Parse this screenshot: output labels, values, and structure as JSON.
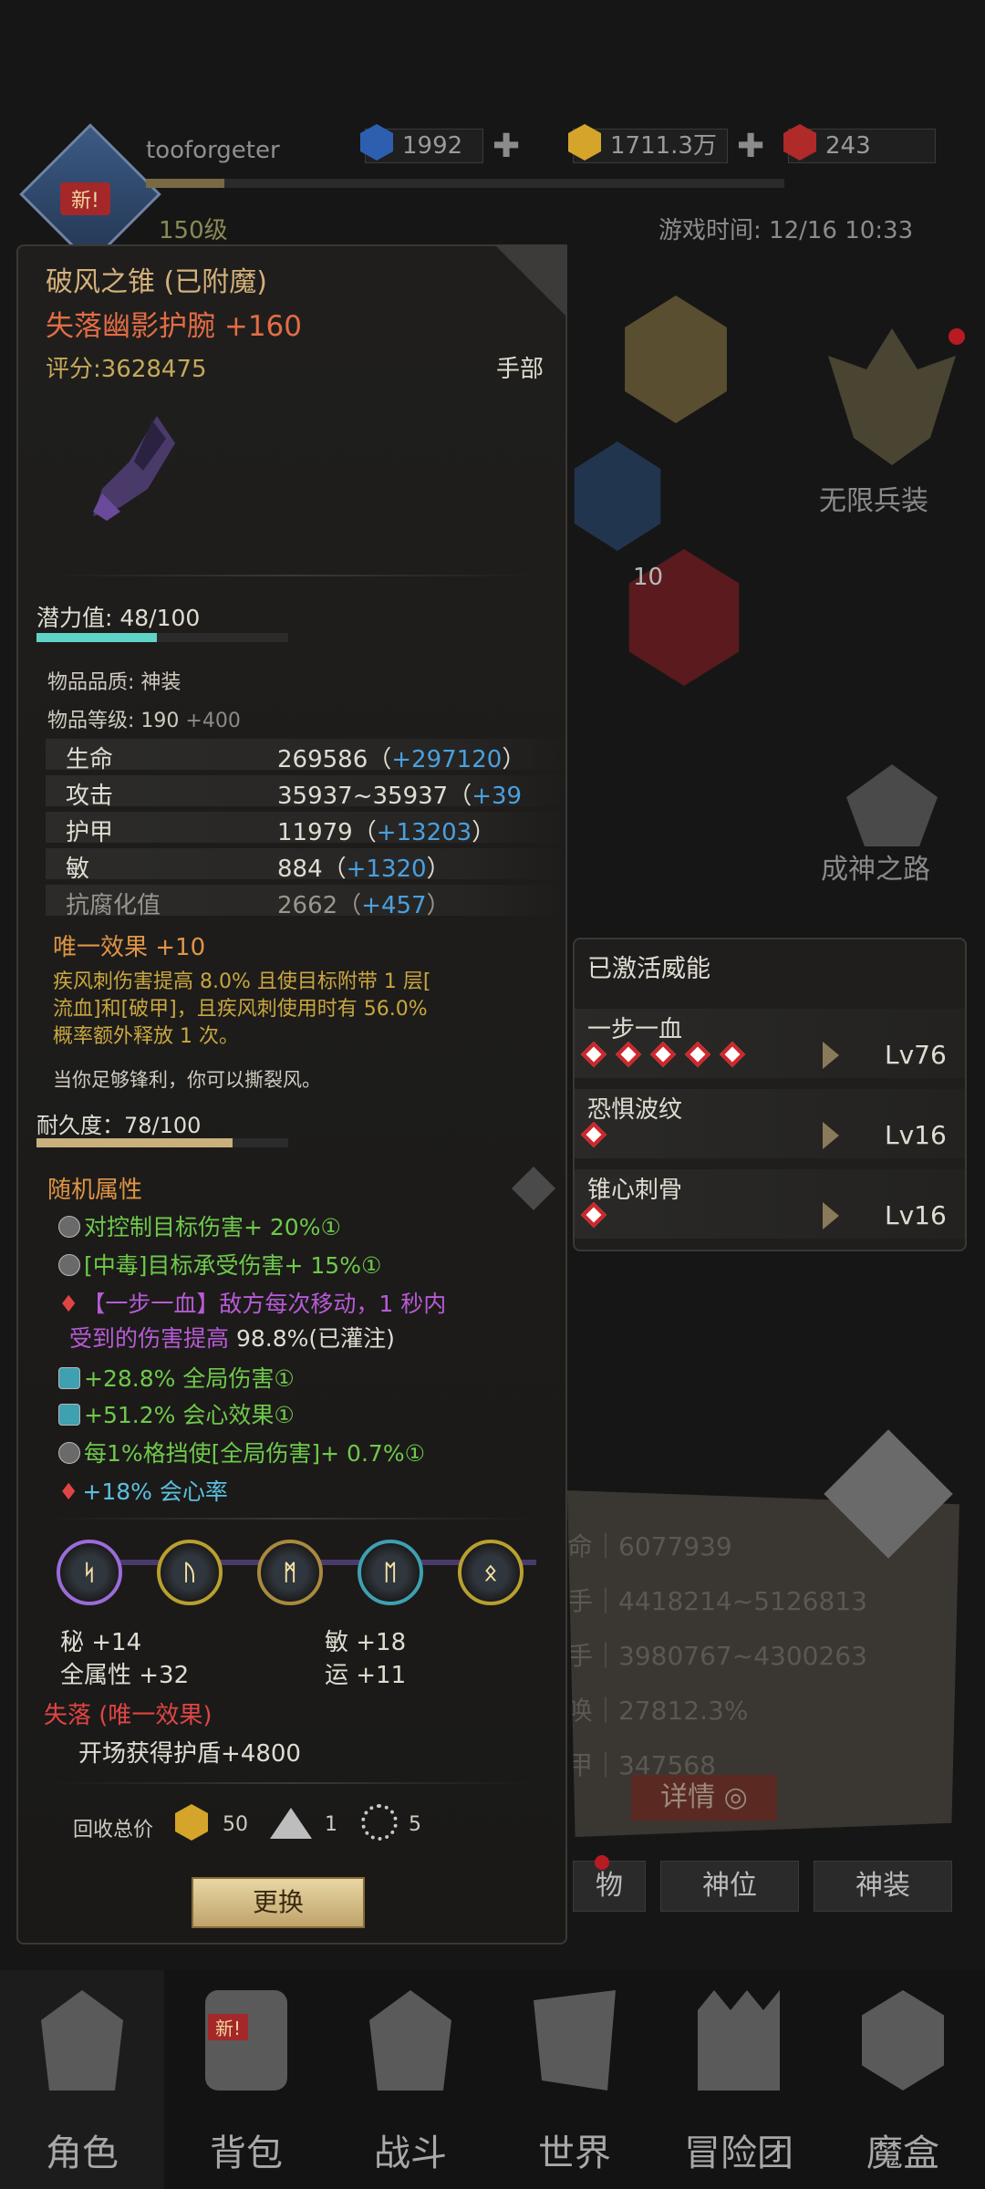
{
  "player": {
    "name": "tooforgeter",
    "level": "150级",
    "new_badge": "新!",
    "game_time": "游戏时间: 12/16 10:33"
  },
  "currency": [
    {
      "icon": "blue-gem-icon",
      "value": "1992",
      "color": "#2d5fb0"
    },
    {
      "icon": "gold-gem-icon",
      "value": "1711.3万",
      "color": "#d4a52a"
    },
    {
      "icon": "red-gem-icon",
      "value": "243",
      "color": "#b02a2a"
    }
  ],
  "side": {
    "infinite_equipment": "无限兵装",
    "godhood_path": "成神之路",
    "hex_level": "10"
  },
  "item": {
    "enchant_title": "破风之锥 (已附魔)",
    "name": "失落幽影护腕 +160",
    "score": "评分:3628475",
    "slot": "手部",
    "potential": "潜力值: 48/100",
    "potential_level": 0.48,
    "quality": "物品品质: 神装",
    "item_level": "物品等级: 190",
    "item_level_bonus": "+400",
    "stats": [
      {
        "key": "生命",
        "base": "269586（",
        "bonus": "+297120",
        "end": "）"
      },
      {
        "key": "攻击",
        "base": "35937~35937（",
        "bonus": "+39",
        "end": ""
      },
      {
        "key": "护甲",
        "base": "11979（",
        "bonus": "+13203",
        "end": "）"
      },
      {
        "key": "敏",
        "base": "884（",
        "bonus": "+1320",
        "end": "）"
      },
      {
        "key": "抗腐化值",
        "base": "2662（",
        "bonus": "+457",
        "end": "）"
      }
    ],
    "unique_title": "唯一效果 +10",
    "unique_desc_1": "疾风刺伤害提高 8.0% 且使目标附带 1 层[",
    "unique_desc_2": "流血]和[破甲]，且疾风刺使用时有 56.0%",
    "unique_desc_3": "概率额外释放 1 次。",
    "flavor": "当你足够锋利，你可以撕裂风。",
    "durability": "耐久度：78/100",
    "durability_level": 0.78,
    "random_title": "随机属性",
    "random": [
      {
        "text": "对控制目标伤害+ 20%①",
        "color": "#6ec94b"
      },
      {
        "text": "[中毒]目标承受伤害+ 15%①",
        "color": "#6ec94b"
      },
      {
        "text": "【一步一血】敌方每次移动，1 秒内",
        "color": "#b75bd6"
      },
      {
        "text": "受到的伤害提高",
        "color": "#b75bd6"
      },
      {
        "text": "98.8%(已灌注)",
        "color": "#e0dcd2"
      },
      {
        "text": "+28.8% 全局伤害①",
        "color": "#6ec94b"
      },
      {
        "text": "+51.2% 会心效果①",
        "color": "#6ec94b"
      },
      {
        "text": "每1%格挡使[全局伤害]+ 0.7%①",
        "color": "#6ec94b"
      },
      {
        "text": "+18% 会心率",
        "color": "#5bc0e0"
      }
    ],
    "gems": [
      "ᛋ",
      "ᚢ",
      "ᛗ",
      "ᛖ",
      "ᛟ"
    ],
    "rune_bonus": [
      {
        "text": "秘 +14"
      },
      {
        "text": "敏 +18"
      },
      {
        "text": "全属性 +32"
      },
      {
        "text": "运 +11"
      }
    ],
    "lost_title": "失落 (唯一效果)",
    "lost_effect": "开场获得护盾+4800",
    "recycle_label": "回收总价",
    "recycle": [
      {
        "icon": "gold-crystal-icon",
        "value": "50"
      },
      {
        "icon": "dust-pile-icon",
        "value": "1"
      },
      {
        "icon": "swirl-essence-icon",
        "value": "5"
      }
    ],
    "replace": "更换"
  },
  "powers": {
    "title": "已激活威能",
    "list": [
      {
        "name": "一步一血",
        "level": "Lv76",
        "diamonds": 5
      },
      {
        "name": "恐惧波纹",
        "level": "Lv16",
        "diamonds": 1
      },
      {
        "name": "锥心刺骨",
        "level": "Lv16",
        "diamonds": 1
      }
    ]
  },
  "bg_stats": {
    "rows": [
      {
        "k": "命",
        "v": "6077939"
      },
      {
        "k": "手",
        "v": "4418214~5126813"
      },
      {
        "k": "手",
        "v": "3980767~4300263"
      },
      {
        "k": "唤",
        "v": "27812.3%"
      },
      {
        "k": "甲",
        "v": "347568"
      }
    ],
    "detail": "详情"
  },
  "tabs": [
    "物",
    "神位",
    "神装"
  ],
  "nav": [
    {
      "label": "角色",
      "icon": "helmet-icon"
    },
    {
      "label": "背包",
      "icon": "backpack-icon"
    },
    {
      "label": "战斗",
      "icon": "swords-icon"
    },
    {
      "label": "世界",
      "icon": "map-icon"
    },
    {
      "label": "冒险团",
      "icon": "castle-icon"
    },
    {
      "label": "魔盒",
      "icon": "cube-icon"
    }
  ],
  "nav_new_badge": "新!"
}
